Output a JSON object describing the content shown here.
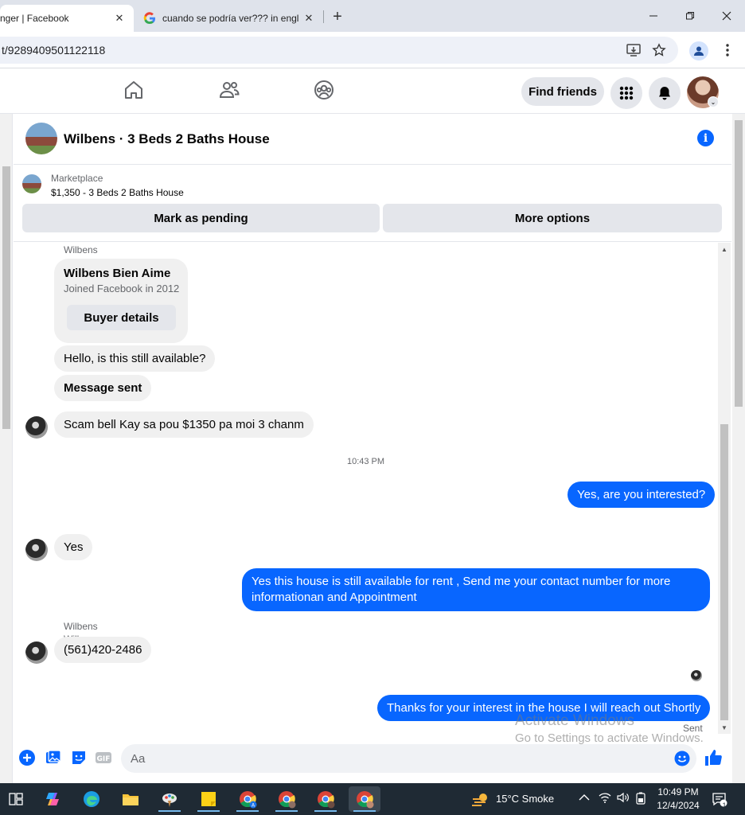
{
  "browser": {
    "tabs": [
      {
        "label": "nger | Facebook",
        "active": true
      },
      {
        "label": "cuando se podría ver??? in engl",
        "active": false
      }
    ],
    "url": "t/9289409501122118"
  },
  "fbnav": {
    "find_friends": "Find friends"
  },
  "chat": {
    "title": "Wilbens · 3 Beds 2 Baths House",
    "listing": {
      "category": "Marketplace",
      "price_title": "$1,350 - 3 Beds 2 Baths House"
    },
    "actions": {
      "mark_pending": "Mark as pending",
      "more_options": "More options"
    },
    "messages": {
      "sender_1": "Wilbens",
      "card_name": "Wilbens Bien Aime",
      "card_sub": "Joined Facebook in 2012",
      "card_button": "Buyer details",
      "msg_1": "Hello, is this still available?",
      "msg_2": "Message sent",
      "msg_3": "Scam bell Kay sa pou $1350 pa moi 3 chanm",
      "timestamp": "10:43 PM",
      "out_1": "Yes, are you interested?",
      "sender_2": "Wilbens",
      "msg_4": "Yes",
      "out_2": "Yes this house is still available for rent , Send me your contact number for more informationan and Appointment",
      "sender_3": "Wilbens",
      "msg_5": "(561)420-2486",
      "out_3": "Thanks for your interest in the house I will reach out Shortly",
      "status": "Sent"
    },
    "composer": {
      "placeholder": "Aa"
    }
  },
  "watermark": {
    "line1": "Activate Windows",
    "line2": "Go to Settings to activate Windows."
  },
  "taskbar": {
    "weather": "15°C  Smoke",
    "time": "10:49 PM",
    "date": "12/4/2024",
    "notifications": "1"
  },
  "colors": {
    "accent": "#0866ff",
    "bubble_in": "#f0f0f0",
    "taskbar": "#1f2a34"
  }
}
